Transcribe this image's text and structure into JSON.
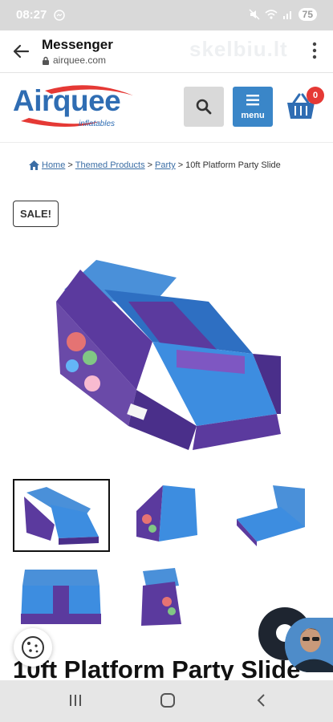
{
  "status_bar": {
    "time": "08:27",
    "battery": "75"
  },
  "browser": {
    "title": "Messenger",
    "url": "airquee.com",
    "watermark": "skelbiu.lt"
  },
  "site": {
    "logo_text": "Airquee",
    "logo_subtitle": "inflatables",
    "menu_label": "menu",
    "cart_count": "0"
  },
  "breadcrumb": {
    "items": [
      "Home",
      "Themed Products",
      "Party"
    ],
    "separator": ">",
    "current": "10ft Platform Party Slide"
  },
  "product": {
    "sale_badge": "SALE!",
    "title": "10ft Platform Party Slide"
  },
  "colors": {
    "brand_blue": "#2f6db3",
    "menu_blue": "#3a86c8",
    "cart_badge": "#e53935",
    "slide_blue": "#4a90d9",
    "slide_purple": "#5b3a9e"
  }
}
